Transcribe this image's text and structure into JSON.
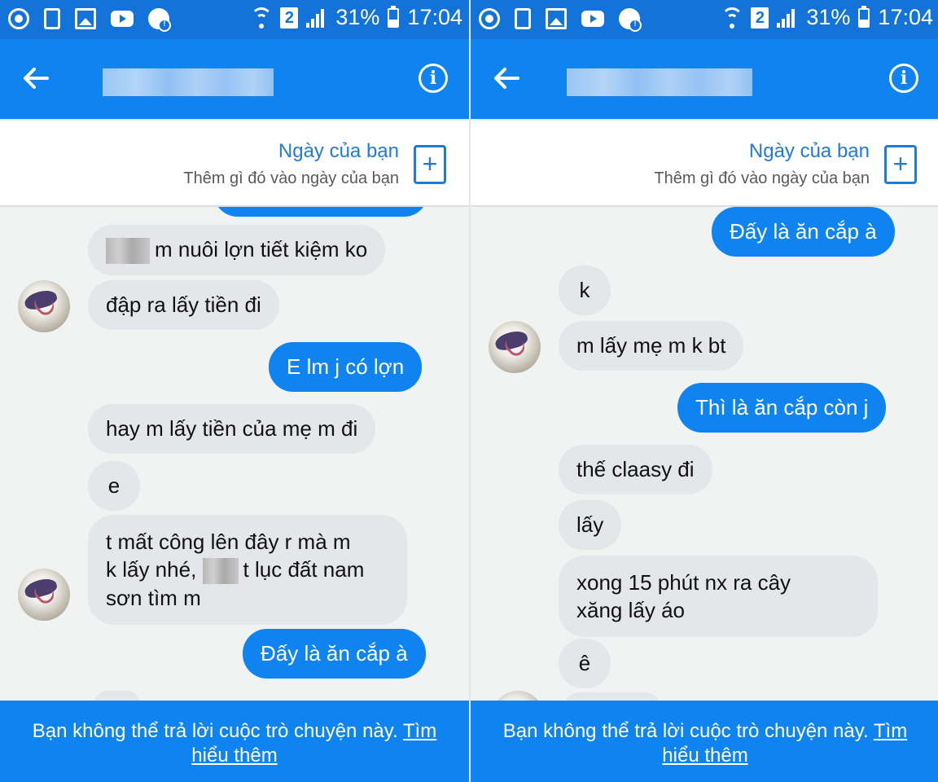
{
  "status_bar": {
    "battery": "31%",
    "time": "17:04",
    "sim_slot": "2",
    "icons_left": [
      "chrome-icon",
      "phone-icon",
      "gallery-icon",
      "youtube-icon",
      "messenger-icon"
    ]
  },
  "colors": {
    "app_blue": "#0f84f0",
    "status_blue": "#1473d8",
    "incoming_bubble": "#e4e6e9",
    "accent_text": "#1f7ad8"
  },
  "your_day": {
    "title": "Ngày của bạn",
    "subtitle": "Thêm gì đó vào ngày của bạn",
    "add_icon": "+"
  },
  "footer": {
    "text": "Bạn không thể trả lời cuộc trò chuyện này.",
    "link_part1": "Tìm",
    "link_part2": "hiểu thêm"
  },
  "left_chat": {
    "messages": [
      {
        "direction": "in",
        "text": "m nuôi lợn tiết kiệm ko",
        "censored_prefix": true
      },
      {
        "direction": "in",
        "text": "đập ra lấy tiền đi"
      },
      {
        "direction": "out",
        "text": "E lm j có lợn"
      },
      {
        "direction": "in",
        "text": "hay m lấy tiền của mẹ m đi"
      },
      {
        "direction": "in",
        "text": "e"
      },
      {
        "direction": "in",
        "line1": "t mất công lên đây r mà m",
        "line2_a": "k lấy nhé,",
        "line2_b": "t lục đất nam",
        "line3": "sơn tìm m"
      },
      {
        "direction": "out",
        "text": "Đấy là ăn cắp à"
      }
    ]
  },
  "right_chat": {
    "messages": [
      {
        "direction": "out",
        "text": "Đấy là ăn cắp à"
      },
      {
        "direction": "in",
        "text": "k"
      },
      {
        "direction": "in",
        "text": "m lấy mẹ m k bt"
      },
      {
        "direction": "out",
        "text": "Thì là ăn cắp còn j"
      },
      {
        "direction": "in",
        "text": "thế claasy đi"
      },
      {
        "direction": "in",
        "text": "lấy"
      },
      {
        "direction": "in",
        "line1": "xong 15 phút nx ra cây",
        "line2": "xăng lấy áo"
      },
      {
        "direction": "in",
        "text": "ê"
      }
    ]
  }
}
